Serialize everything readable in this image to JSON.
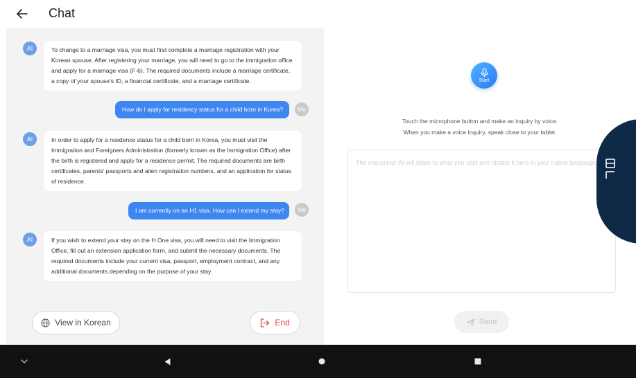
{
  "header": {
    "title": "Chat",
    "back_icon": "arrow-left-icon"
  },
  "chat": {
    "ai_avatar_label": "AI",
    "me_avatar_label": "Me",
    "messages": [
      {
        "sender": "AI",
        "text": "To change to a marriage visa, you must first complete a marriage registration with your Korean spouse. After registering your marriage, you will need to go to the immigration office and apply for a marriage visa (F-6). The required documents include a marriage certificate, a copy of your spouse's ID, a financial certificate, and a marriage certificate."
      },
      {
        "sender": "Me",
        "text": "How do I apply for residency status for a child born in Korea?"
      },
      {
        "sender": "AI",
        "text": "In order to apply for a residence status for a child born in Korea, you must visit the Immigration and Foreigners Administration (formerly known as the Immigration Office) after the birth is registered and apply for a residence permit. The required documents are birth certificates, parents' passports and alien registration numbers, and an application for status of residence."
      },
      {
        "sender": "Me",
        "text": "I am currently on an H1 visa. How can I extend my stay?"
      },
      {
        "sender": "AI",
        "text": "If you wish to extend your stay on the H One visa, you will need to visit the Immigration Office, fill out an extension application form, and submit the necessary documents. The required documents include your current visa, passport, employment contract, and any additional documents depending on the purpose of your stay."
      }
    ],
    "view_korean_label": "View in Korean",
    "view_korean_icon": "globe-icon",
    "end_label": "End",
    "end_icon": "logout-icon"
  },
  "voice": {
    "mic_label": "Start",
    "mic_icon": "microphone-icon",
    "instruction_line1": "Touch the microphone button and make an inquiry by voice.",
    "instruction_line2": "When you make a voice inquiry, speak close to your tablet.",
    "dictation_placeholder": "The interpreter AI will listen to what you said and dictate it here in your native language.",
    "send_label": "Send",
    "send_icon": "send-icon"
  },
  "floating": {
    "icon": "document-scan-icon"
  },
  "navbar": {
    "icons": [
      "chevron-down-icon",
      "back-triangle-icon",
      "home-circle-icon",
      "recents-square-icon"
    ]
  },
  "colors": {
    "accent_blue": "#3e86f0",
    "ai_avatar": "#6c9fe6",
    "end_red": "#e5473a",
    "float_navy": "#0e2a47",
    "chat_bg": "#f3f3f3"
  }
}
